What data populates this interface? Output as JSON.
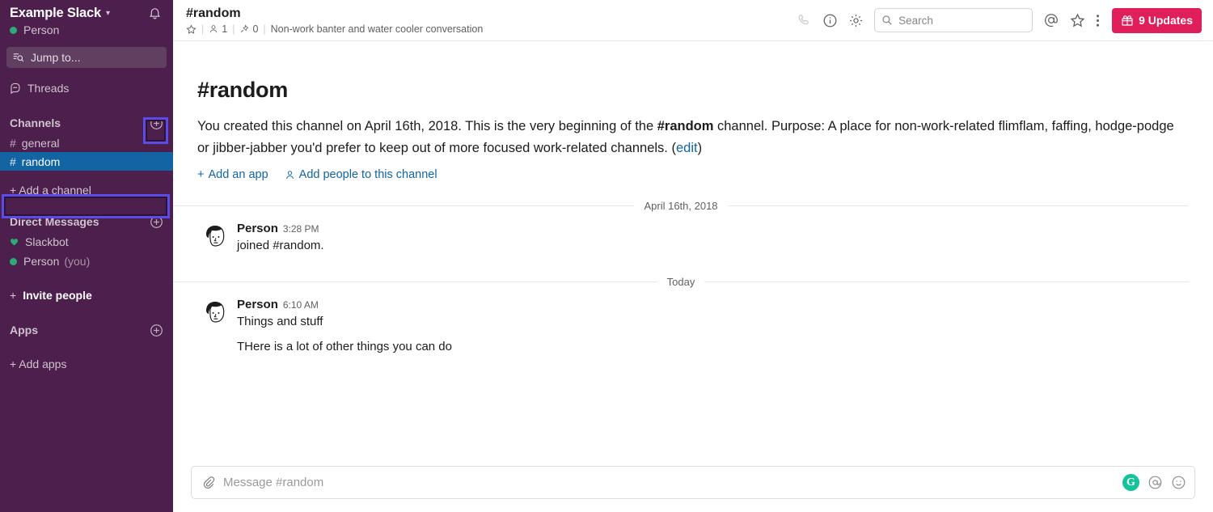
{
  "sidebar": {
    "team_name": "Example Slack",
    "team_caret": "chevron-down",
    "user_name": "Person",
    "jump_to": "Jump to...",
    "threads_label": "Threads",
    "channels_section": "Channels",
    "channels": [
      {
        "name": "general",
        "active": false
      },
      {
        "name": "random",
        "active": true
      }
    ],
    "add_channel_label": "+ Add a channel",
    "dm_section": "Direct Messages",
    "dms": [
      {
        "name": "Slackbot",
        "mark": "heart",
        "suffix": ""
      },
      {
        "name": "Person",
        "mark": "dot",
        "suffix": "(you)"
      }
    ],
    "invite_people_label": "Invite people",
    "apps_section": "Apps",
    "add_apps_label": "+ Add apps"
  },
  "header": {
    "channel_title": "#random",
    "member_count": "1",
    "pin_count": "0",
    "topic": "Non-work banter and water cooler conversation",
    "search_placeholder": "Search",
    "updates_label": "9 Updates"
  },
  "intro": {
    "title": "#random",
    "text_1": "You created this channel on April 16th, 2018. This is the very beginning of the ",
    "channel_bold": "#random",
    "text_2": " channel. Purpose: A place for non-work-related flimflam, faffing, hodge-podge or jibber-jabber you'd prefer to keep out of more focused work-related channels. (",
    "edit_link": "edit",
    "text_3": ")",
    "add_app_label": "Add an app",
    "add_people_label": "Add people to this channel"
  },
  "conversation": {
    "dividers": {
      "first": "April 16th, 2018",
      "second": "Today"
    },
    "messages": [
      {
        "author": "Person",
        "time": "3:28 PM",
        "line1": "joined #random.",
        "line2": ""
      },
      {
        "author": "Person",
        "time": "6:10 AM",
        "line1": "Things and stuff",
        "line2": "THere is a lot of other things you can do"
      }
    ]
  },
  "composer": {
    "placeholder": "Message #random",
    "grammarly_letter": "G"
  },
  "colors": {
    "sidebar_bg": "#4d1f4c",
    "active_channel": "#1264a3",
    "updates_badge": "#e01e5a",
    "link": "#1264a3",
    "presence_green": "#2bac76",
    "highlight": "#5b4be8",
    "grammarly_green": "#15c39a"
  }
}
